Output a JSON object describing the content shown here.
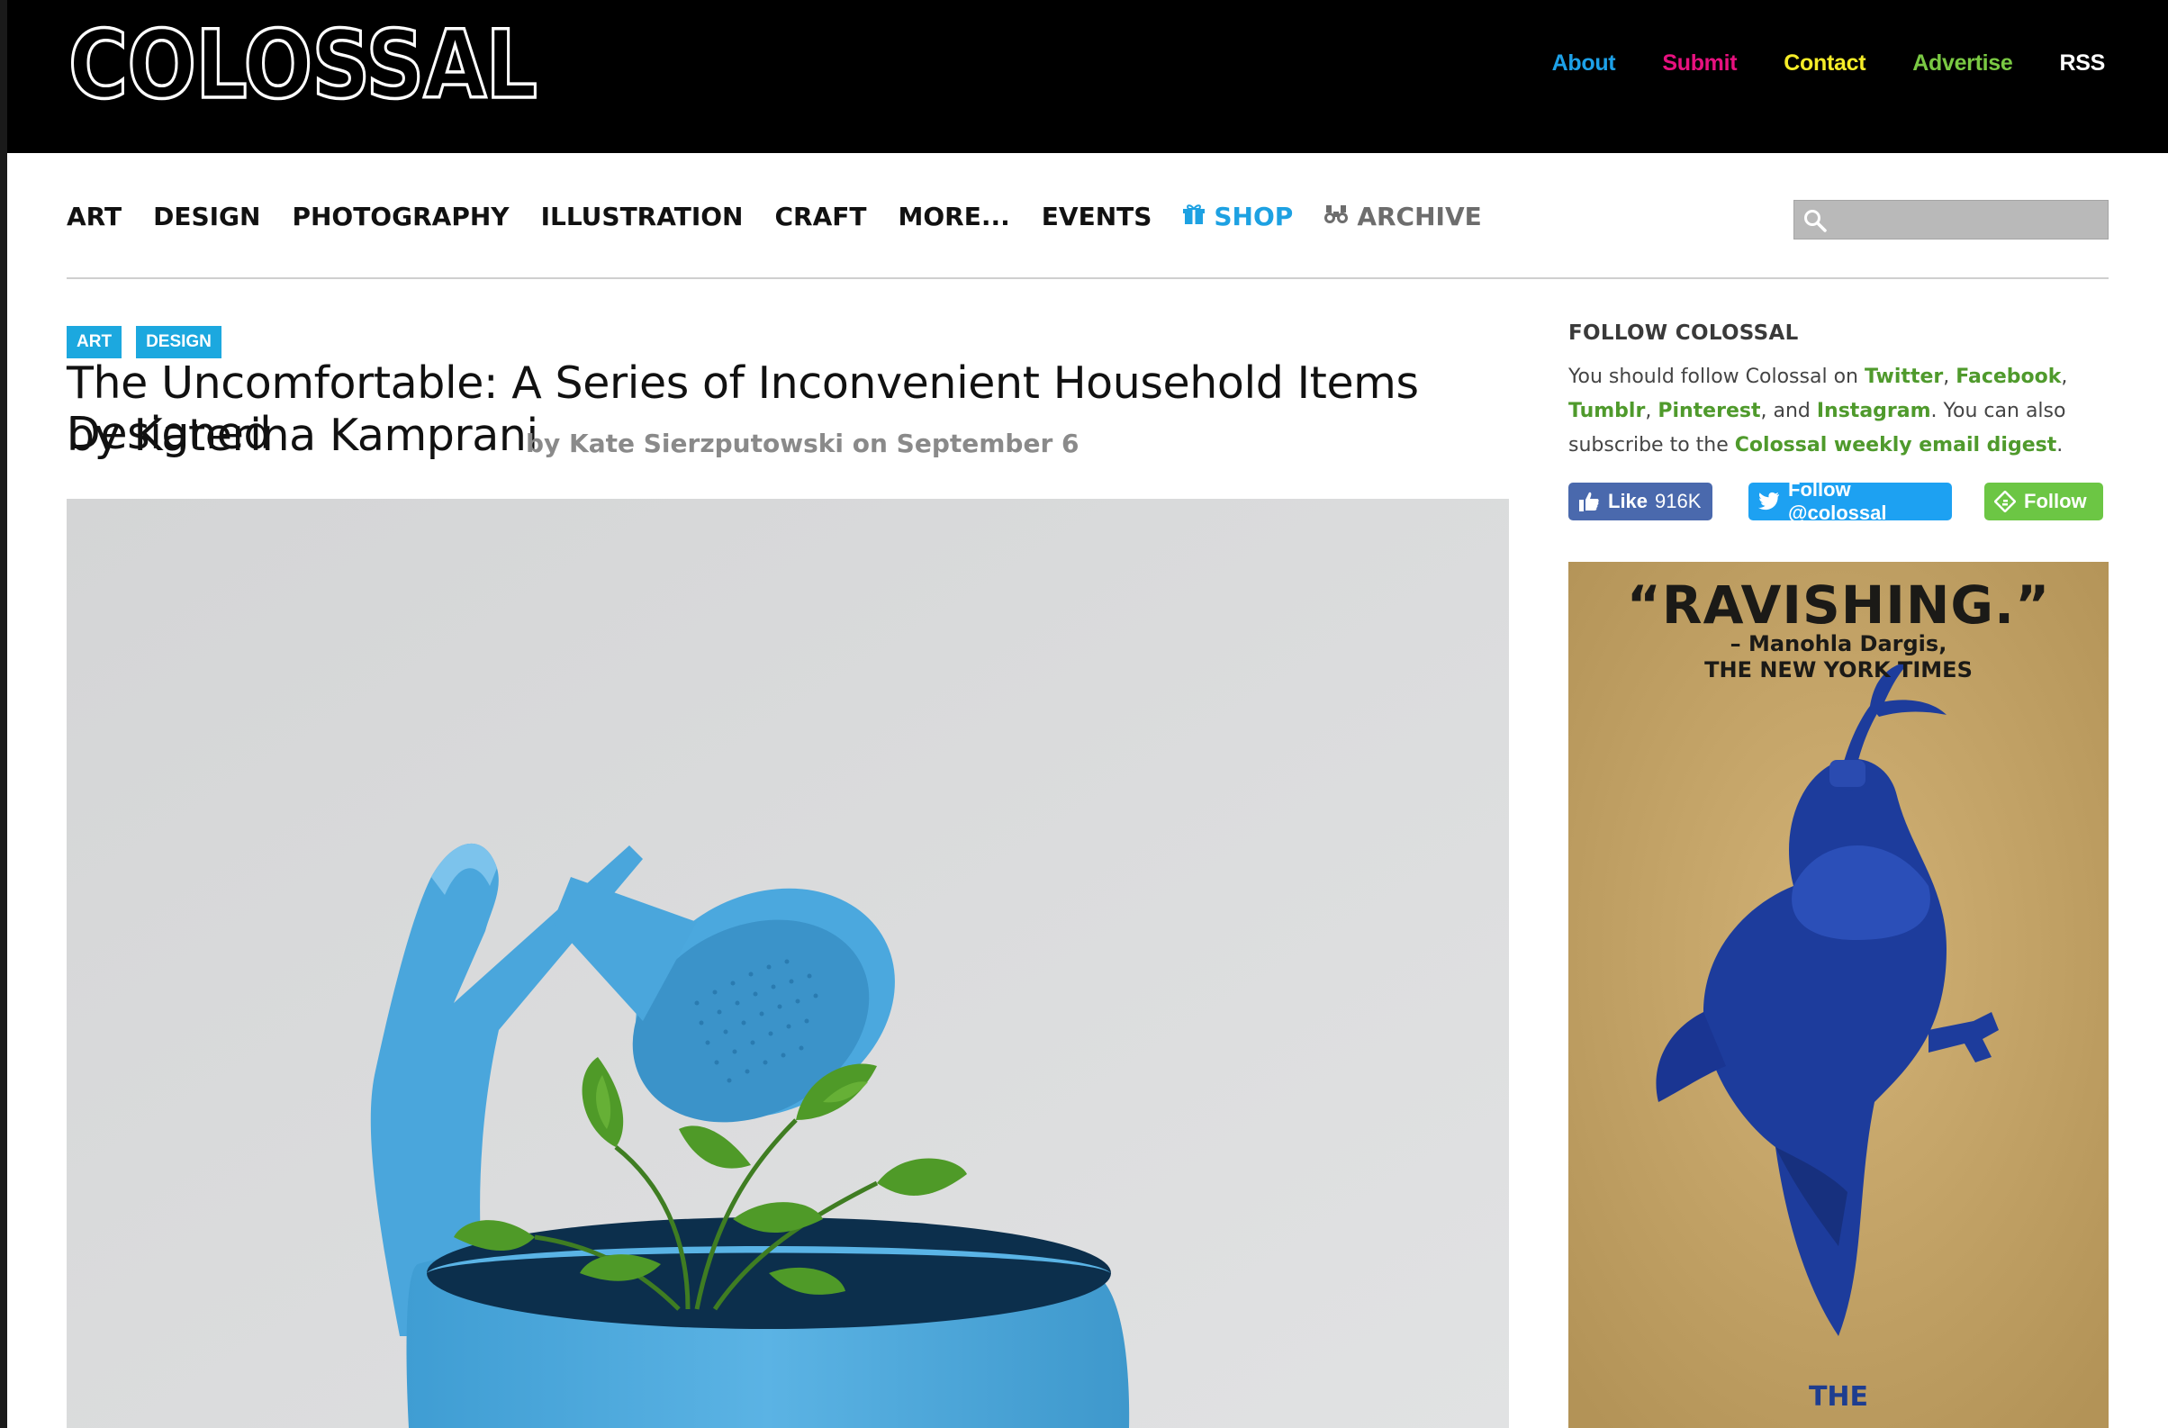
{
  "site": {
    "logo_text": "COLOSSAL",
    "top_links": [
      {
        "label": "About",
        "color": "#1da1e8"
      },
      {
        "label": "Submit",
        "color": "#e8117f"
      },
      {
        "label": "Contact",
        "color": "#f5ec28"
      },
      {
        "label": "Advertise",
        "color": "#7ac943"
      },
      {
        "label": "RSS",
        "color": "#ffffff"
      }
    ]
  },
  "nav": {
    "items": [
      "ART",
      "DESIGN",
      "PHOTOGRAPHY",
      "ILLUSTRATION",
      "CRAFT",
      "MORE...",
      "EVENTS"
    ],
    "shop": {
      "label": "SHOP",
      "icon": "gift-icon",
      "color": "#1da1e2"
    },
    "archive": {
      "label": "ARCHIVE",
      "icon": "binoculars-icon",
      "color": "#6d6d6d"
    },
    "search": {
      "placeholder": "",
      "icon": "search-icon"
    }
  },
  "article": {
    "tags": [
      "ART",
      "DESIGN"
    ],
    "title_line1": "The Uncomfortable: A Series of Inconvenient Household Items Designed",
    "title_line2": "by Katerina Kamprani",
    "byline_prefix": "by",
    "author": "Kate Sierzputowski",
    "date_prefix": "on",
    "date": "September 6"
  },
  "sidebar": {
    "follow_title": "FOLLOW COLOSSAL",
    "follow_text": {
      "p1": "You should follow Colossal on ",
      "twitter": "Twitter",
      "sep1": ", ",
      "facebook": "Facebook",
      "sep2": ",",
      "tumblr": "Tumblr",
      "sep3": ", ",
      "pinterest": "Pinterest",
      "sep4": ", and ",
      "instagram": "Instagram",
      "p2": ". You can also subscribe to the ",
      "digest": "Colossal weekly email digest",
      "p3": "."
    },
    "buttons": {
      "like_label": "Like",
      "like_count": "916K",
      "twitter_label": "Follow @colossal",
      "feedly_label": "Follow"
    }
  },
  "ad": {
    "quote": "“RAVISHING.”",
    "attribution_name": "– Manohla Dargis,",
    "attribution_pub": "THE NEW YORK TIMES",
    "bottom_word": "THE"
  }
}
